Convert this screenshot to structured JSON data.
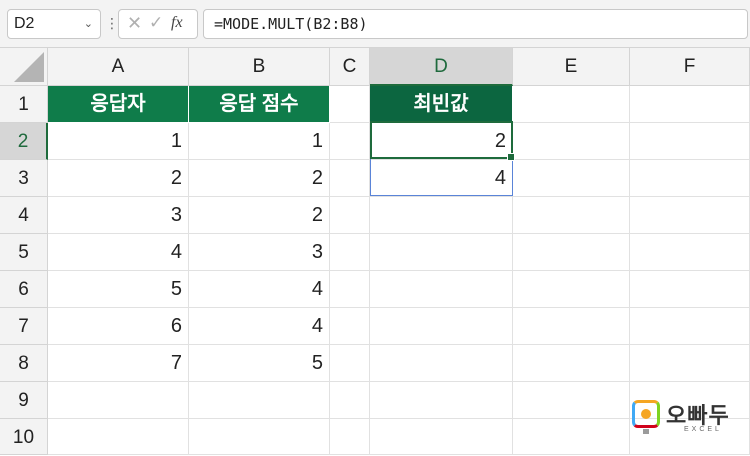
{
  "formula_bar": {
    "name_box": "D2",
    "formula": "=MODE.MULT(B2:B8)",
    "fx_label": "fx"
  },
  "columns": [
    "A",
    "B",
    "C",
    "D",
    "E",
    "F"
  ],
  "selected_column": "D",
  "rows": [
    "1",
    "2",
    "3",
    "4",
    "5",
    "6",
    "7",
    "8",
    "9",
    "10"
  ],
  "selected_row": "2",
  "table": {
    "headers": [
      "응답자",
      "응답 점수"
    ],
    "respondents": [
      "1",
      "2",
      "3",
      "4",
      "5",
      "6",
      "7"
    ],
    "scores": [
      "1",
      "2",
      "2",
      "3",
      "4",
      "4",
      "5"
    ]
  },
  "result": {
    "header": "최빈값",
    "values": [
      "2",
      "4"
    ]
  },
  "logo": {
    "name": "오빠두",
    "subtitle": "EXCEL"
  },
  "colors": {
    "header_green": "#0f7c4a",
    "header_dark_green": "#0c6640",
    "selection_green": "#1e6b3c",
    "spill_blue": "#5a84d8"
  }
}
